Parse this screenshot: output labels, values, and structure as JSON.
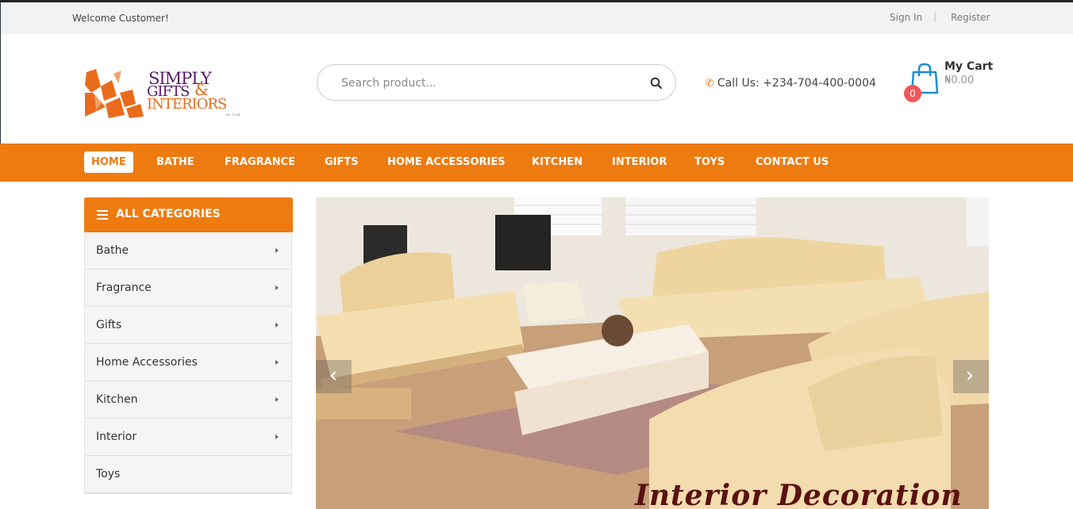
{
  "topbar": {
    "welcome": "Welcome Customer!",
    "sign_in": "Sign In",
    "separator": "|",
    "register": "Register"
  },
  "logo": {
    "line1": "SIMPLY",
    "line2": "GIFTS",
    "ampersand": "&",
    "line3": "INTERIORS",
    "tagline": "RC 1234"
  },
  "search": {
    "placeholder": "Search product...",
    "icon": "search-icon"
  },
  "contact": {
    "label": "Call Us: +234-704-400-0004",
    "icon": "phone-icon"
  },
  "cart": {
    "title": "My Cart",
    "amount": "₦0.00",
    "count": "0",
    "icon": "shopping-bag-icon"
  },
  "nav": {
    "items": [
      {
        "label": "HOME",
        "active": true
      },
      {
        "label": "BATHE"
      },
      {
        "label": "FRAGRANCE"
      },
      {
        "label": "GIFTS"
      },
      {
        "label": "HOME ACCESSORIES"
      },
      {
        "label": "KITCHEN"
      },
      {
        "label": "INTERIOR"
      },
      {
        "label": "TOYS"
      },
      {
        "label": "CONTACT US"
      }
    ]
  },
  "categories": {
    "title": "ALL CATEGORIES",
    "items": [
      {
        "label": "Bathe",
        "has_submenu": true
      },
      {
        "label": "Fragrance",
        "has_submenu": true
      },
      {
        "label": "Gifts",
        "has_submenu": true
      },
      {
        "label": "Home Accessories",
        "has_submenu": true
      },
      {
        "label": "Kitchen",
        "has_submenu": true
      },
      {
        "label": "Interior",
        "has_submenu": true
      },
      {
        "label": "Toys",
        "has_submenu": false
      }
    ]
  },
  "slider": {
    "caption": "Interior Decoration"
  },
  "colors": {
    "accent": "#ee7b10",
    "logo_purple": "#5a1a6b",
    "badge": "#f25757",
    "cart_icon": "#1a8fd1"
  }
}
